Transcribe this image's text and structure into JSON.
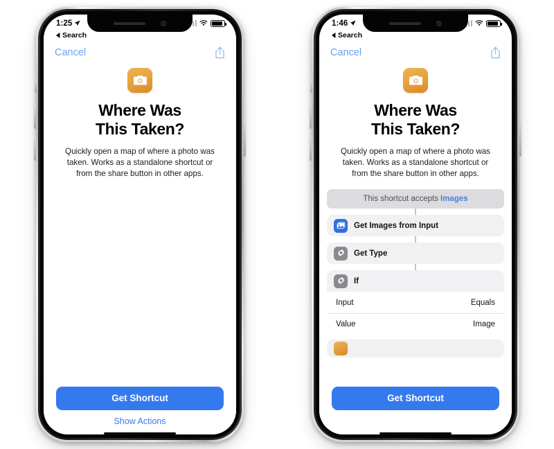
{
  "phones": [
    {
      "id": "left",
      "status_bar": {
        "time": "1:25",
        "location_icon": "location-arrow-icon",
        "signal_icon": "cellular-signal-icon",
        "wifi_icon": "wifi-icon",
        "battery_icon": "battery-icon"
      },
      "back_link": {
        "icon": "back-triangle-icon",
        "label": "Search"
      },
      "navbar": {
        "cancel_label": "Cancel",
        "share_icon": "share-icon"
      },
      "app_icon": "camera-icon",
      "title": "Where Was\nThis Taken?",
      "title_line1": "Where Was",
      "title_line2": "This Taken?",
      "description": "Quickly open a map of where a photo was taken. Works as a standalone shortcut or from the share button in other apps.",
      "shows_actions": false,
      "footer": {
        "primary_label": "Get Shortcut",
        "secondary_label": "Show Actions"
      }
    },
    {
      "id": "right",
      "status_bar": {
        "time": "1:46",
        "location_icon": "location-arrow-icon",
        "signal_icon": "cellular-signal-icon",
        "wifi_icon": "wifi-icon",
        "battery_icon": "battery-icon"
      },
      "back_link": {
        "icon": "back-triangle-icon",
        "label": "Search"
      },
      "navbar": {
        "cancel_label": "Cancel",
        "share_icon": "share-icon"
      },
      "app_icon": "camera-icon",
      "title_line1": "Where Was",
      "title_line2": "This Taken?",
      "description": "Quickly open a map of where a photo was taken. Works as a standalone shortcut or from the share button in other apps.",
      "shows_actions": true,
      "actions": {
        "accepts_prefix": "This shortcut accepts",
        "accepts_type": "Images",
        "items": [
          {
            "icon": "photo-stack-icon",
            "icon_color": "#2f6fe4",
            "label": "Get Images from Input",
            "params": []
          },
          {
            "icon": "gear-icon",
            "icon_color": "#8a8a8f",
            "label": "Get Type",
            "params": []
          },
          {
            "icon": "gear-icon",
            "icon_color": "#8a8a8f",
            "label": "If",
            "params": [
              {
                "name": "Input",
                "value": "Equals"
              },
              {
                "name": "Value",
                "value": "Image"
              }
            ]
          }
        ],
        "partial_item_icon": "shortcut-action-icon"
      },
      "footer": {
        "primary_label": "Get Shortcut",
        "secondary_label": ""
      }
    }
  ],
  "colors": {
    "accent_blue": "#3579ef",
    "link_blue": "#6aa0ef",
    "accepts_link": "#4b7fd4",
    "icon_orange": "#e8a33f",
    "action_gray": "#8a8a8f",
    "card_bg": "#f1f1f3",
    "banner_bg": "#dcdcde"
  }
}
